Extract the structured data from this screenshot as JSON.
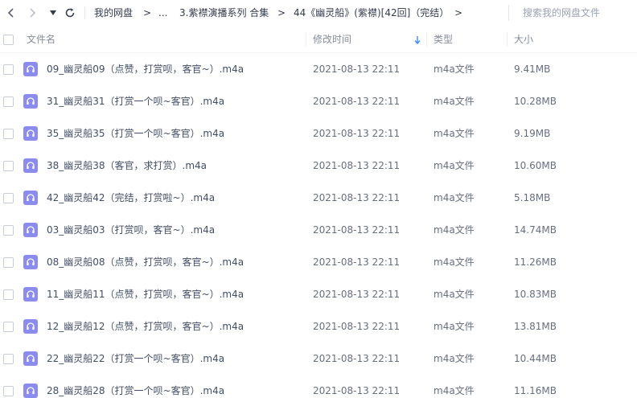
{
  "toolbar": {
    "back_icon": "chevron-left-icon",
    "forward_icon": "chevron-right-icon",
    "history_icon": "caret-down-icon",
    "refresh_icon": "refresh-icon"
  },
  "breadcrumb": {
    "items": [
      "我的网盘",
      "...",
      "3.紫襟演播系列 合集",
      "44《幽灵船》(紫襟)[42回]（完结）"
    ],
    "separator": ">"
  },
  "search": {
    "placeholder": "搜索我的网盘文件"
  },
  "columns": {
    "name": "文件名",
    "modified": "修改时间",
    "type": "类型",
    "size": "大小",
    "sort_icon": "sort-arrow-down-icon"
  },
  "accent_color": "#8c8cf0",
  "files": [
    {
      "name": "09_幽灵船09（点赞，打赏呗，客官~）.m4a",
      "modified": "2021-08-13 22:11",
      "type": "m4a文件",
      "size": "9.41MB",
      "icon": "audio-file-icon"
    },
    {
      "name": "31_幽灵船31（打赏一个呗~客官）.m4a",
      "modified": "2021-08-13 22:11",
      "type": "m4a文件",
      "size": "10.28MB",
      "icon": "audio-file-icon"
    },
    {
      "name": "35_幽灵船35（打赏一个呗~客官）.m4a",
      "modified": "2021-08-13 22:11",
      "type": "m4a文件",
      "size": "9.19MB",
      "icon": "audio-file-icon"
    },
    {
      "name": "38_幽灵船38（客官，求打赏）.m4a",
      "modified": "2021-08-13 22:11",
      "type": "m4a文件",
      "size": "10.60MB",
      "icon": "audio-file-icon"
    },
    {
      "name": "42_幽灵船42（完结，打赏啦~）.m4a",
      "modified": "2021-08-13 22:11",
      "type": "m4a文件",
      "size": "5.18MB",
      "icon": "audio-file-icon"
    },
    {
      "name": "03_幽灵船03（打赏呗，客官~）.m4a",
      "modified": "2021-08-13 22:11",
      "type": "m4a文件",
      "size": "14.74MB",
      "icon": "audio-file-icon"
    },
    {
      "name": "08_幽灵船08（点赞，打赏呗，客官~）.m4a",
      "modified": "2021-08-13 22:11",
      "type": "m4a文件",
      "size": "11.26MB",
      "icon": "audio-file-icon"
    },
    {
      "name": "11_幽灵船11（点赞，打赏呗，客官~）.m4a",
      "modified": "2021-08-13 22:11",
      "type": "m4a文件",
      "size": "10.83MB",
      "icon": "audio-file-icon"
    },
    {
      "name": "12_幽灵船12（点赞，打赏呗，客官~）.m4a",
      "modified": "2021-08-13 22:11",
      "type": "m4a文件",
      "size": "13.81MB",
      "icon": "audio-file-icon"
    },
    {
      "name": "22_幽灵船22（打赏一个呗~客官）.m4a",
      "modified": "2021-08-13 22:11",
      "type": "m4a文件",
      "size": "10.44MB",
      "icon": "audio-file-icon"
    },
    {
      "name": "28_幽灵船28（打赏一个呗~客官）.m4a",
      "modified": "2021-08-13 22:11",
      "type": "m4a文件",
      "size": "11.16MB",
      "icon": "audio-file-icon"
    }
  ]
}
